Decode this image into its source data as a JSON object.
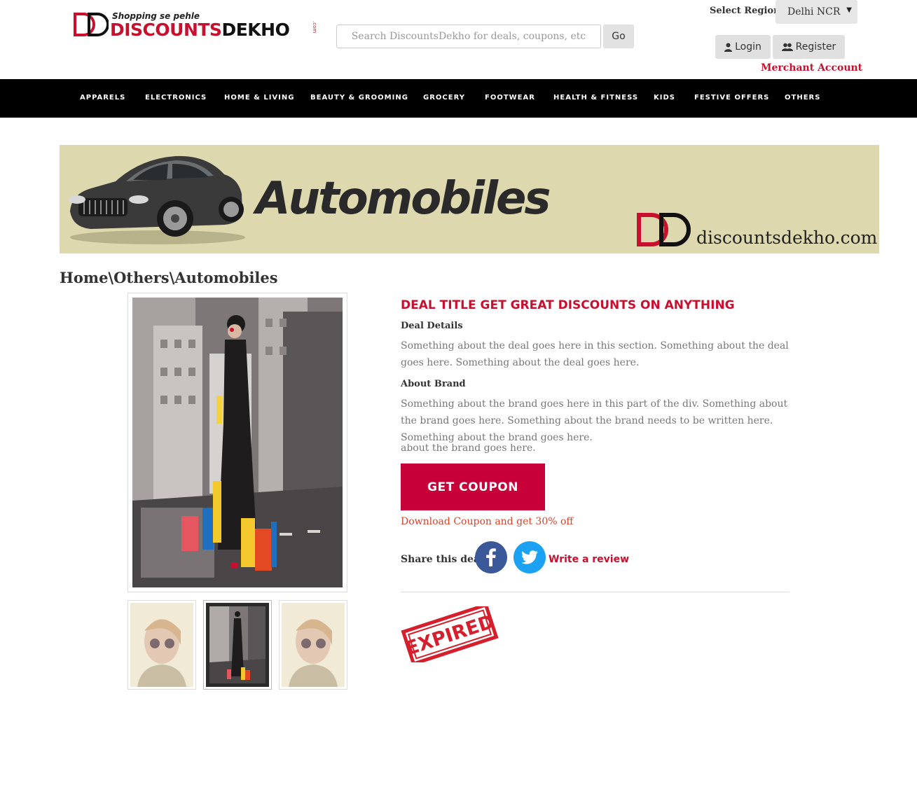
{
  "header": {
    "logo_tagline": "Shopping se pehle",
    "logo_word_red": "DISCOUNTS",
    "logo_word_black": "DEKHO",
    "logo_com": ".com",
    "search_placeholder": "Search DiscountsDekho for deals, coupons, etc",
    "go_label": "Go",
    "region_label": "Select Region",
    "region_value": "Delhi NCR",
    "login_label": "Login",
    "register_label": "Register",
    "merchant_label": "Merchant Account"
  },
  "nav": {
    "items": [
      "APPARELS",
      "ELECTRONICS",
      "HOME & LIVING",
      "BEAUTY & GROOMING",
      "GROCERY",
      "FOOTWEAR",
      "HEALTH & FITNESS",
      "KIDS",
      "FESTIVE OFFERS",
      "OTHERS"
    ]
  },
  "banner": {
    "title": "Automobiles",
    "site": "discountsdekho.com"
  },
  "breadcrumb": "Home\\Others\\Automobiles",
  "deal": {
    "title": "DEAL TITLE GET GREAT DISCOUNTS ON ANYTHING",
    "details_label": "Deal Details",
    "details_text": "Something about the deal goes here in this section. Something about the deal goes here. Something about the deal goes here.",
    "brand_label": "About Brand",
    "brand_text": "Something about the brand goes here in this part of the div. Something about the brand goes here. Something about the brand needs to be written here. Something about the brand goes here.",
    "brand_overflow": "about the brand goes here.",
    "coupon_label": "GET COUPON",
    "coupon_note": "Download Coupon and get 30% off",
    "share_label": "Share this deal:",
    "review_label": "Write a review",
    "stamp_text": "EXPIRED"
  },
  "colors": {
    "brand_red": "#c8102e",
    "coupon_red": "#c8003a",
    "nav_bg": "#000000",
    "banner_bg": "#ddd8ae",
    "facebook": "#3b5998",
    "twitter": "#1da1f2"
  },
  "icons": {
    "login": "user-icon",
    "register": "users-icon",
    "facebook": "facebook-icon",
    "twitter": "twitter-icon"
  }
}
